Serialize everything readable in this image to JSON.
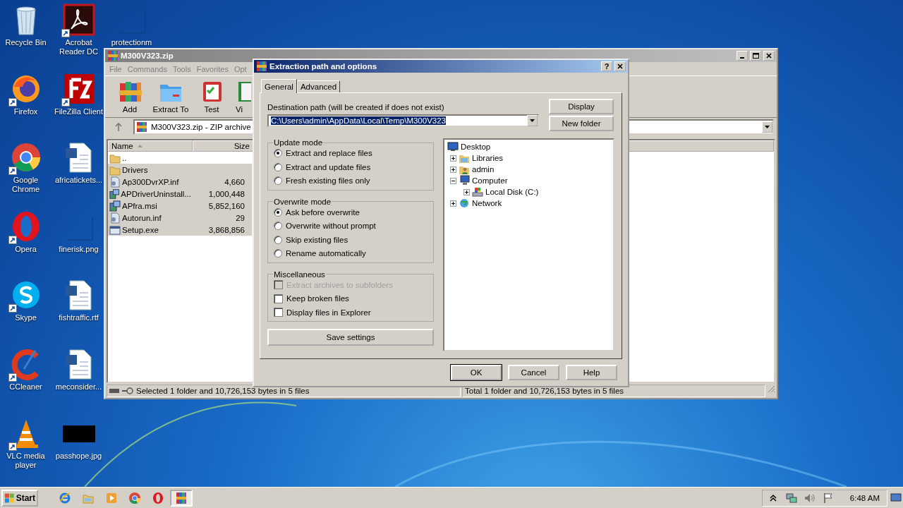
{
  "desktop_icons": [
    {
      "label": "Recycle Bin",
      "kind": "recycle",
      "shortcut": false
    },
    {
      "label": "Firefox",
      "kind": "firefox",
      "shortcut": true
    },
    {
      "label": "Google Chrome",
      "kind": "chrome",
      "shortcut": true
    },
    {
      "label": "Opera",
      "kind": "opera",
      "shortcut": true
    },
    {
      "label": "Skype",
      "kind": "skype",
      "shortcut": true
    },
    {
      "label": "CCleaner",
      "kind": "ccleaner",
      "shortcut": true
    },
    {
      "label": "VLC media player",
      "kind": "vlc",
      "shortcut": true
    },
    {
      "label": "Acrobat Reader DC",
      "kind": "pdf",
      "shortcut": true
    },
    {
      "label": "FileZilla Client",
      "kind": "filezilla",
      "shortcut": true
    },
    {
      "label": "africatickets...",
      "kind": "word",
      "shortcut": false
    },
    {
      "label": "finerisk.png",
      "kind": "image",
      "shortcut": false
    },
    {
      "label": "fishtraffic.rtf",
      "kind": "word",
      "shortcut": false
    },
    {
      "label": "meconsider...",
      "kind": "word",
      "shortcut": false
    },
    {
      "label": "passhope.jpg",
      "kind": "black",
      "shortcut": false
    },
    {
      "label": "protectionm",
      "kind": "image",
      "shortcut": false
    }
  ],
  "archive_window": {
    "title": "M300V323.zip",
    "menu": [
      "File",
      "Commands",
      "Tools",
      "Favorites",
      "Opt"
    ],
    "toolbar": [
      {
        "label": "Add",
        "kind": "add"
      },
      {
        "label": "Extract To",
        "kind": "extract"
      },
      {
        "label": "Test",
        "kind": "test"
      },
      {
        "label": "Vi",
        "kind": "view"
      }
    ],
    "address": "M300V323.zip - ZIP archive",
    "columns": [
      "Name",
      "Size"
    ],
    "rows": [
      {
        "name": "..",
        "size": "",
        "kind": "up",
        "selected": false
      },
      {
        "name": "Drivers",
        "size": "",
        "kind": "folder",
        "selected": true
      },
      {
        "name": "Ap300DvrXP.inf",
        "size": "4,660",
        "kind": "inf",
        "selected": true
      },
      {
        "name": "APDriverUninstall...",
        "size": "1,000,448",
        "kind": "msi",
        "selected": true
      },
      {
        "name": "APfra.msi",
        "size": "5,852,160",
        "kind": "msi",
        "selected": true
      },
      {
        "name": "Autorun.inf",
        "size": "29",
        "kind": "inf",
        "selected": true
      },
      {
        "name": "Setup.exe",
        "size": "3,868,856",
        "kind": "exe",
        "selected": true
      }
    ],
    "status_left": "Selected 1 folder and 10,726,153 bytes in 5 files",
    "status_right": "Total 1 folder and 10,726,153 bytes in 5 files"
  },
  "dialog": {
    "title": "Extraction path and options",
    "help_button": "?",
    "tabs": [
      {
        "label": "General",
        "selected": true
      },
      {
        "label": "Advanced",
        "selected": false
      }
    ],
    "path_label": "Destination path (will be created if does not exist)",
    "path_value": "C:\\Users\\admin\\AppData\\Local\\Temp\\M300V323",
    "side_buttons": [
      "Display",
      "New folder"
    ],
    "groups": [
      {
        "title": "Update mode",
        "kind": "radio",
        "options": [
          {
            "label": "Extract and replace files",
            "selected": true
          },
          {
            "label": "Extract and update files",
            "selected": false
          },
          {
            "label": "Fresh existing files only",
            "selected": false
          }
        ]
      },
      {
        "title": "Overwrite mode",
        "kind": "radio",
        "options": [
          {
            "label": "Ask before overwrite",
            "selected": true
          },
          {
            "label": "Overwrite without prompt",
            "selected": false
          },
          {
            "label": "Skip existing files",
            "selected": false
          },
          {
            "label": "Rename automatically",
            "selected": false
          }
        ]
      },
      {
        "title": "Miscellaneous",
        "kind": "check",
        "options": [
          {
            "label": "Extract archives to subfolders",
            "checked": false,
            "disabled": true
          },
          {
            "label": "Keep broken files",
            "checked": false,
            "disabled": false
          },
          {
            "label": "Display files in Explorer",
            "checked": false,
            "disabled": false
          }
        ]
      }
    ],
    "save_button": "Save settings",
    "tree": [
      {
        "label": "Desktop",
        "kind": "desktop",
        "children": [
          {
            "label": "Libraries",
            "kind": "libraries",
            "expanded": false
          },
          {
            "label": "admin",
            "kind": "user",
            "expanded": false
          },
          {
            "label": "Computer",
            "kind": "computer",
            "expanded": true,
            "children": [
              {
                "label": "Local Disk (C:)",
                "kind": "disk",
                "expanded": false
              }
            ]
          },
          {
            "label": "Network",
            "kind": "network",
            "expanded": false
          }
        ]
      }
    ],
    "buttons": [
      "OK",
      "Cancel",
      "Help"
    ]
  },
  "taskbar": {
    "start": "Start",
    "items": [
      {
        "kind": "ie",
        "selected": false
      },
      {
        "kind": "explorer",
        "selected": false
      },
      {
        "kind": "media",
        "selected": false
      },
      {
        "kind": "chrome",
        "selected": false
      },
      {
        "kind": "opera",
        "selected": false
      },
      {
        "kind": "winrar",
        "selected": true
      }
    ],
    "tray": [
      {
        "kind": "chevron"
      },
      {
        "kind": "network"
      },
      {
        "kind": "volume"
      },
      {
        "kind": "flag"
      }
    ],
    "clock": "6:48 AM"
  }
}
